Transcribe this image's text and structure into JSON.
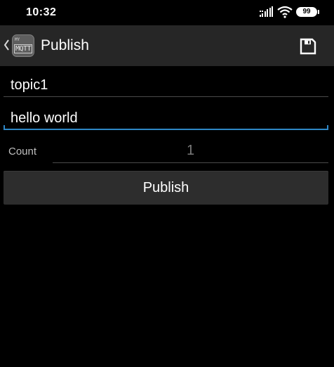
{
  "status_bar": {
    "time": "10:32",
    "battery": "99"
  },
  "app_bar": {
    "logo_small": "MY",
    "logo_main": "MQTT",
    "title": "Publish",
    "save_icon": "save-icon"
  },
  "form": {
    "topic_value": "topic1",
    "message_value": "hello world",
    "count_label": "Count",
    "count_value": "1",
    "publish_label": "Publish"
  },
  "colors": {
    "background": "#000000",
    "app_bar": "#262626",
    "accent": "#2e87c6",
    "button": "#2d2d2d"
  }
}
